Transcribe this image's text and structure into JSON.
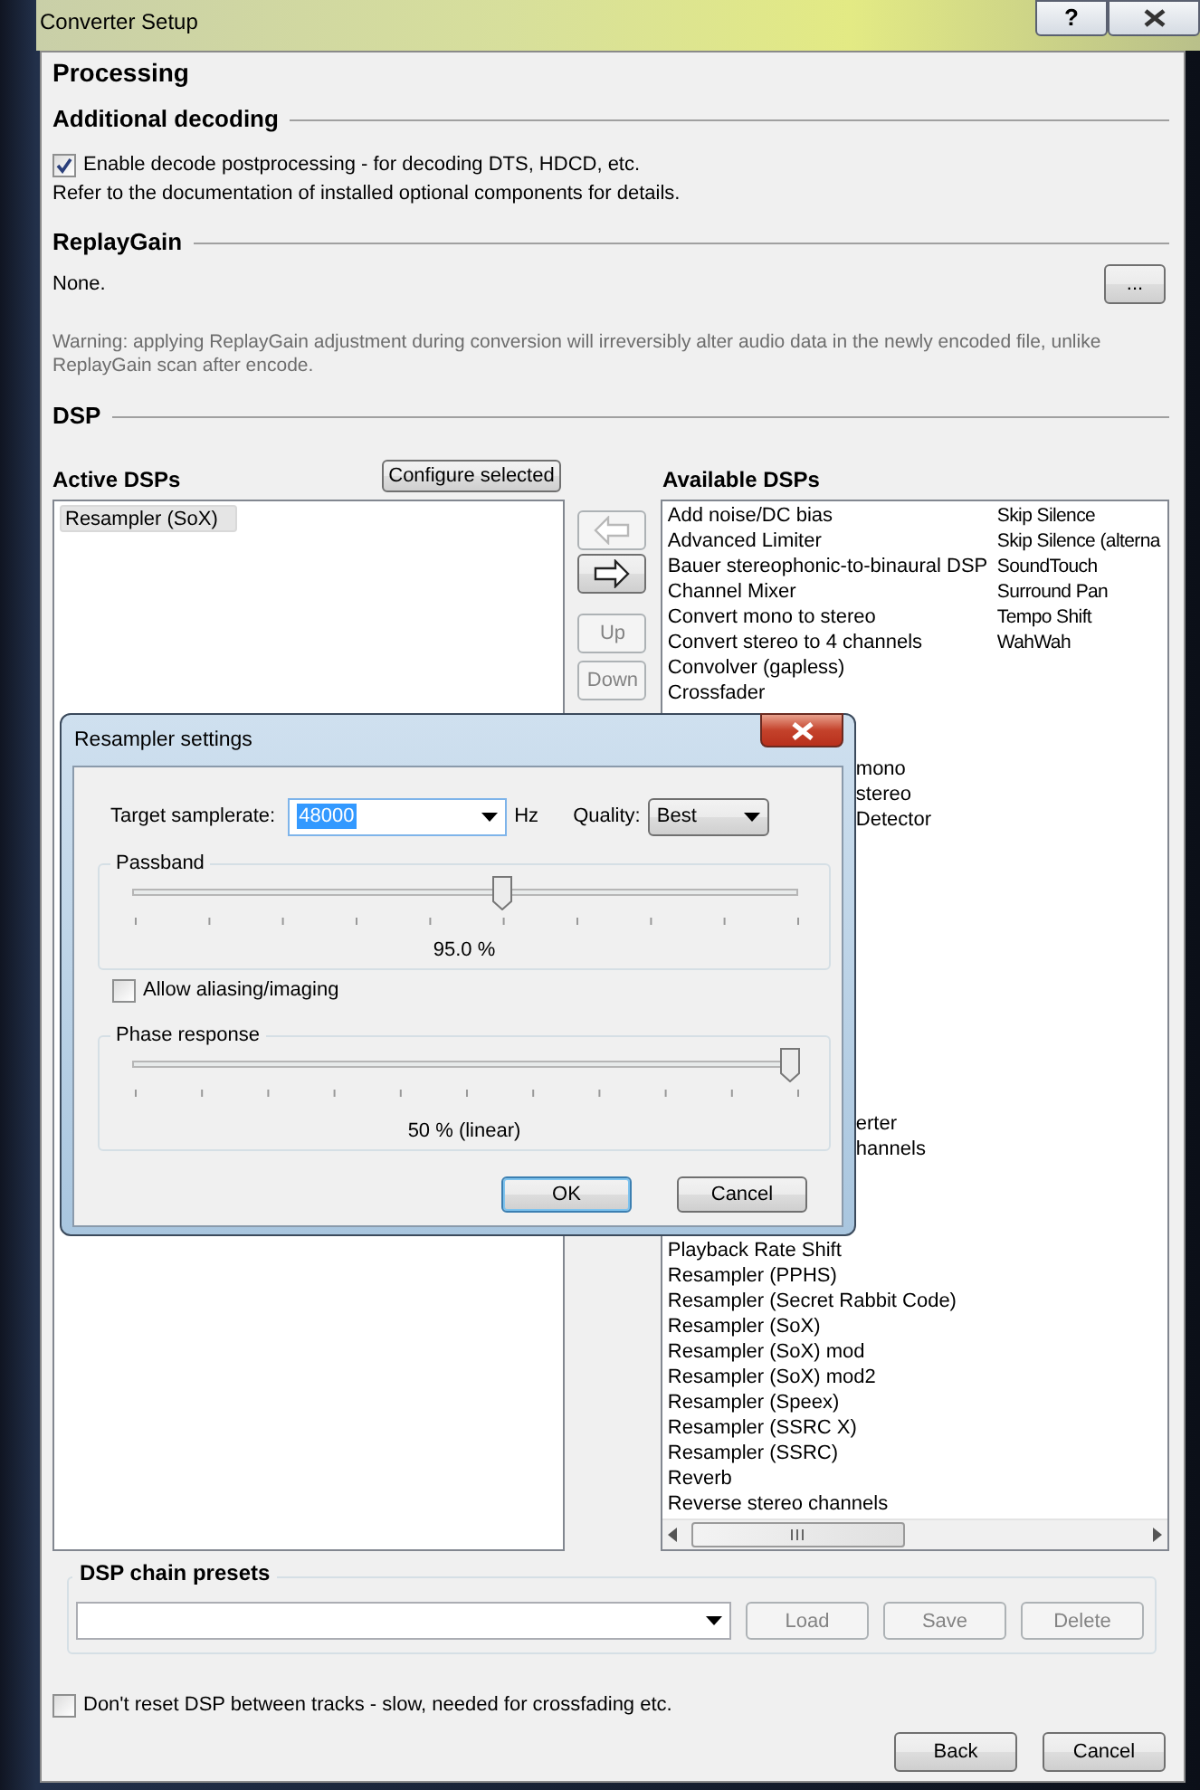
{
  "window": {
    "title": "Converter Setup",
    "help_button": "?"
  },
  "heading": "Processing",
  "additional_decoding": {
    "title": "Additional decoding",
    "checkbox": {
      "label": "Enable decode postprocessing - for decoding DTS, HDCD, etc.",
      "checked": true
    },
    "note": "Refer to the documentation of installed optional components for details."
  },
  "replaygain": {
    "title": "ReplayGain",
    "value": "None.",
    "button": "...",
    "warning": "Warning: applying ReplayGain adjustment during conversion will irreversibly alter audio data in the newly encoded file, unlike ReplayGain scan after encode."
  },
  "dsp": {
    "title": "DSP",
    "active": {
      "title": "Active DSPs",
      "configure_button": "Configure selected",
      "items": [
        {
          "text": "Resampler (SoX)",
          "selected": true
        }
      ]
    },
    "move_buttons": [
      {
        "kind": "left",
        "disabled": true
      },
      {
        "kind": "right",
        "disabled": false
      },
      {
        "kind": "text",
        "label": "Up",
        "disabled": true
      },
      {
        "kind": "text",
        "label": "Down",
        "disabled": true
      }
    ],
    "available": {
      "title": "Available DSPs",
      "column_1": [
        {
          "kind": "item",
          "text": "Add noise/DC bias"
        },
        {
          "kind": "item",
          "text": "Advanced Limiter"
        },
        {
          "kind": "item",
          "text": "Bauer stereophonic-to-binaural DSP"
        },
        {
          "kind": "item",
          "text": "Channel Mixer"
        },
        {
          "kind": "item",
          "text": "Convert mono to stereo"
        },
        {
          "kind": "item",
          "text": "Convert stereo to 4 channels"
        },
        {
          "kind": "item",
          "text": "Convolver (gapless)"
        },
        {
          "kind": "item",
          "text": "Crossfader"
        },
        {
          "kind": "covered"
        },
        {
          "kind": "covered"
        },
        {
          "kind": "clipped",
          "text": "mono"
        },
        {
          "kind": "clipped",
          "text": "stereo"
        },
        {
          "kind": "clipped",
          "text": "Detector"
        },
        {
          "kind": "covered"
        },
        {
          "kind": "covered"
        },
        {
          "kind": "covered"
        },
        {
          "kind": "covered"
        },
        {
          "kind": "covered"
        },
        {
          "kind": "covered"
        },
        {
          "kind": "covered"
        },
        {
          "kind": "covered"
        },
        {
          "kind": "covered"
        },
        {
          "kind": "covered"
        },
        {
          "kind": "covered"
        },
        {
          "kind": "clipped",
          "text": "erter"
        },
        {
          "kind": "clipped",
          "text": "hannels"
        },
        {
          "kind": "covered"
        },
        {
          "kind": "covered"
        },
        {
          "kind": "covered"
        },
        {
          "kind": "item",
          "text": "Playback Rate Shift"
        },
        {
          "kind": "item",
          "text": "Resampler (PPHS)"
        },
        {
          "kind": "item",
          "text": "Resampler (Secret Rabbit Code)"
        },
        {
          "kind": "item",
          "text": "Resampler (SoX)"
        },
        {
          "kind": "item",
          "text": "Resampler (SoX) mod"
        },
        {
          "kind": "item",
          "text": "Resampler (SoX) mod2"
        },
        {
          "kind": "item",
          "text": "Resampler (Speex)"
        },
        {
          "kind": "item",
          "text": "Resampler (SSRC X)"
        },
        {
          "kind": "item",
          "text": "Resampler (SSRC)"
        },
        {
          "kind": "item",
          "text": "Reverb"
        },
        {
          "kind": "item",
          "text": "Reverse stereo channels"
        }
      ],
      "column_2": [
        "Skip Silence",
        "Skip Silence (alterna",
        "SoundTouch",
        "Surround Pan",
        "Tempo Shift",
        "WahWah"
      ]
    }
  },
  "presets": {
    "title": "DSP chain presets",
    "buttons": [
      {
        "label": "Load",
        "disabled": true
      },
      {
        "label": "Save",
        "disabled": true
      },
      {
        "label": "Delete",
        "disabled": true
      }
    ]
  },
  "reset_checkbox": {
    "label": "Don't reset DSP between tracks - slow, needed for crossfading etc.",
    "checked": false
  },
  "buttons": [
    {
      "label": "Back"
    },
    {
      "label": "Cancel"
    }
  ],
  "dialog": {
    "title": "Resampler settings",
    "samplerate_label": "Target samplerate:",
    "samplerate": "48000",
    "unit": "Hz",
    "quality_label": "Quality:",
    "quality": "Best",
    "passband": {
      "title": "Passband",
      "level": 0.555,
      "reading": "95.0 %"
    },
    "aliasing": {
      "label": "Allow aliasing/imaging",
      "checked": false
    },
    "phase": {
      "title": "Phase response",
      "level": 0.986,
      "reading": "50 % (linear)"
    },
    "buttons": [
      {
        "label": "OK",
        "focused": true
      },
      {
        "label": "Cancel",
        "focused": false
      }
    ]
  }
}
